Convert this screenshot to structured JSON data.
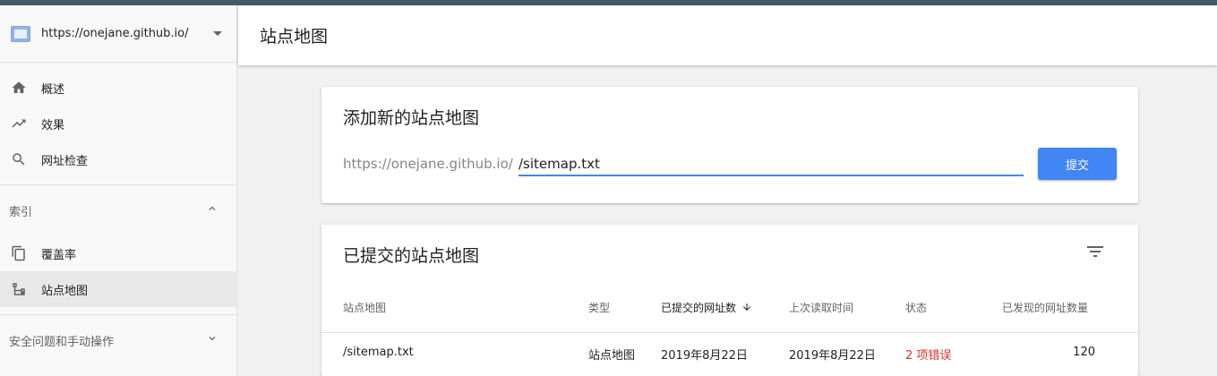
{
  "property": {
    "url": "https://onejane.github.io/"
  },
  "nav": {
    "overview": "概述",
    "performance": "效果",
    "url_inspection": "网址检查"
  },
  "index_section": {
    "title": "索引",
    "coverage": "覆盖率",
    "sitemaps": "站点地图"
  },
  "security_section": {
    "title": "安全问题和手动操作"
  },
  "header": {
    "title": "站点地图"
  },
  "add_card": {
    "title": "添加新的站点地图",
    "prefix": "https://onejane.github.io/",
    "input_value": "/sitemap.txt",
    "submit_label": "提交"
  },
  "submitted_card": {
    "title": "已提交的站点地图",
    "columns": {
      "sitemap": "站点地图",
      "type": "类型",
      "submitted": "已提交的网址数",
      "last_read": "上次读取时间",
      "status": "状态",
      "discovered": "已发现的网址数量"
    },
    "rows": [
      {
        "sitemap": "/sitemap.txt",
        "type": "站点地图",
        "submitted": "2019年8月22日",
        "last_read": "2019年8月22日",
        "status": "2 项错误",
        "discovered": "120"
      }
    ]
  },
  "colors": {
    "accent": "#4285f4",
    "error": "#d93025",
    "topbar": "#455a64"
  }
}
